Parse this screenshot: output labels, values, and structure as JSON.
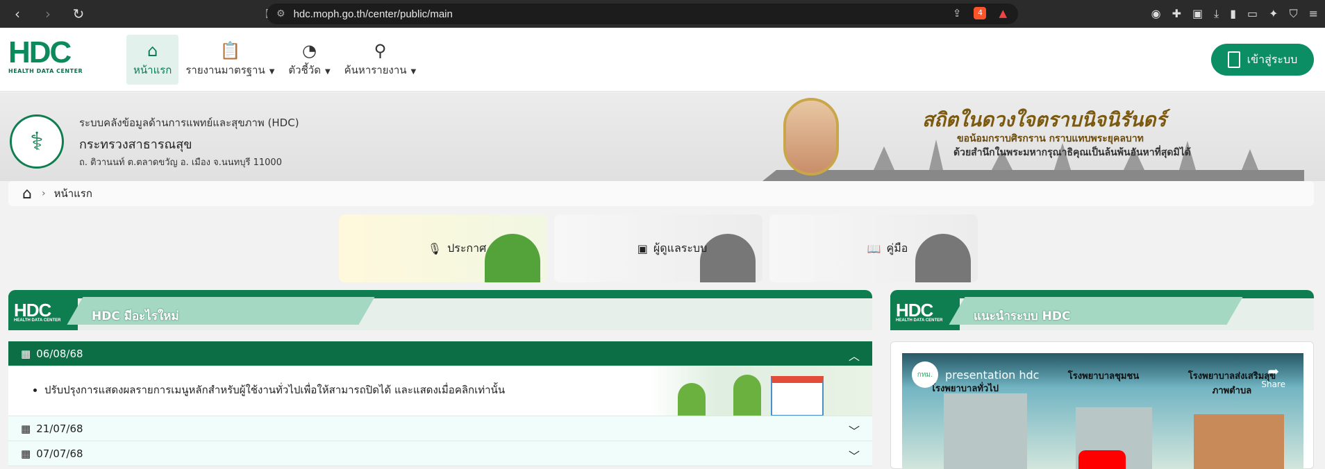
{
  "browser": {
    "url": "hdc.moph.go.th/center/public/main",
    "brave_badge": "4"
  },
  "header": {
    "logo_text": "HDC",
    "logo_sub": "HEALTH DATA CENTER",
    "menu": [
      {
        "label": "หน้าแรก",
        "icon": "home-icon",
        "active": true
      },
      {
        "label": "รายงานมาตรฐาน",
        "icon": "clipboard-icon",
        "dropdown": true
      },
      {
        "label": "ตัวชี้วัด",
        "icon": "gauge-icon",
        "dropdown": true
      },
      {
        "label": "ค้นหารายงาน",
        "icon": "search-icon",
        "dropdown": true
      }
    ],
    "login_label": "เข้าสู่ระบบ"
  },
  "hero": {
    "org_line1": "ระบบคลังข้อมูลด้านการแพทย์และสุขภาพ (HDC)",
    "org_line2": "กระทรวงสาธารณสุข",
    "org_line3": "ถ. ติวานนท์ ต.ตลาดขวัญ อ. เมือง จ.นนทบุรี 11000",
    "slogan": "สถิตในดวงใจตราบนิจนิรันดร์",
    "slogan_sub1": "ขอน้อมกราบศิรกราน กราบแทบพระยุคลบาท",
    "slogan_sub2": "ด้วยสำนึกในพระมหากรุณาธิคุณเป็นล้นพ้นอันหาที่สุดมิได้"
  },
  "breadcrumb": {
    "current": "หน้าแรก"
  },
  "cards": [
    {
      "label": "ประกาศ",
      "icon": "microphone-icon"
    },
    {
      "label": "ผู้ดูแลระบบ",
      "icon": "admin-badge-icon"
    },
    {
      "label": "คู่มือ",
      "icon": "book-icon"
    }
  ],
  "sections": {
    "news_title": "HDC มีอะไรใหม่",
    "intro_title": "แนะนำระบบ HDC",
    "hdc_small": "HEALTH DATA CENTER"
  },
  "news": [
    {
      "date": "06/08/68",
      "open": true,
      "items": [
        "ปรับปรุงการแสดงผลรายการเมนูหลักสำหรับผู้ใช้งานทั่วไปเพื่อให้สามารถปิดได้ และแสดงเมื่อคลิกเท่านั้น"
      ]
    },
    {
      "date": "21/07/68",
      "open": false
    },
    {
      "date": "07/07/68",
      "open": false
    }
  ],
  "video": {
    "title": "presentation hdc",
    "channel": "กทม.",
    "share_label": "Share",
    "columns": [
      "โรงพยาบาลทั่วไป",
      "โรงพยาบาลชุมชน",
      "โรงพยาบาลส่งเสริมสุขภาพตำบล"
    ]
  },
  "colors": {
    "primary_green": "#0b8e63",
    "dark_green": "#0b6e45",
    "light_green": "#a4d8c2"
  }
}
